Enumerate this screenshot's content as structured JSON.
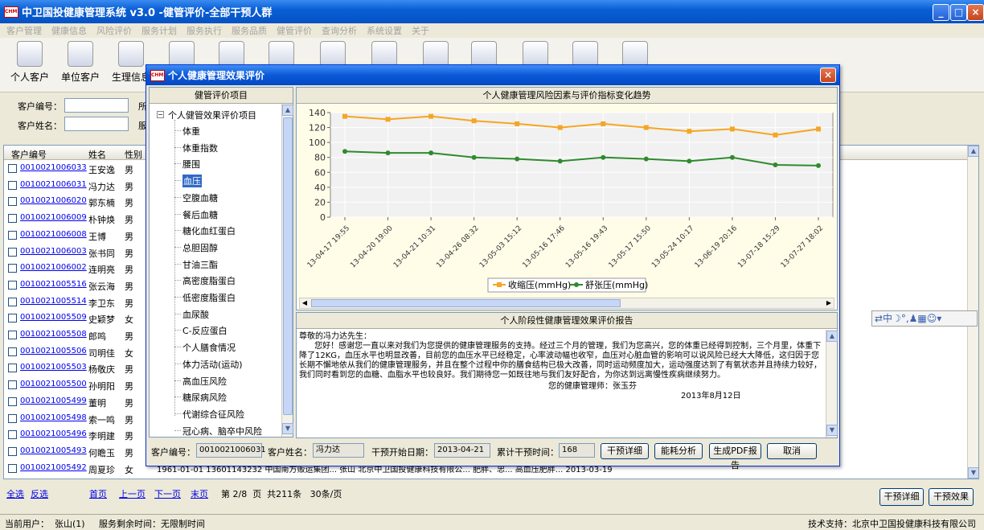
{
  "app": {
    "title": "中卫国投健康管理系统 v3.0 -健管评价-全部干预人群",
    "logo_text": "CHMI",
    "window_buttons": [
      "_",
      "□",
      "×"
    ]
  },
  "menu": [
    "客户管理",
    "健康信息",
    "风险评价",
    "服务计划",
    "服务执行",
    "服务品质",
    "健管评价",
    "查询分析",
    "系统设置",
    "关于"
  ],
  "toolbar": [
    {
      "label": "个人客户",
      "icon": "person-icon"
    },
    {
      "label": "单位客户",
      "icon": "group-icon"
    },
    {
      "label": "生理信息",
      "icon": "document-pencil-icon"
    },
    {
      "label": "",
      "icon": "record-icon"
    },
    {
      "label": "",
      "icon": "magnifier-icon"
    },
    {
      "label": "",
      "icon": "printer-icon"
    },
    {
      "label": "",
      "icon": "add-document-icon"
    },
    {
      "label": "",
      "icon": "warning-icon"
    },
    {
      "label": "",
      "icon": "chart-icon"
    },
    {
      "label": "",
      "icon": "users-icon"
    },
    {
      "label": "",
      "icon": "print-icon"
    },
    {
      "label": "",
      "icon": "refresh-icon"
    },
    {
      "label": "",
      "icon": "power-icon"
    }
  ],
  "filter": {
    "customer_id_label": "客户编号：",
    "customer_name_label": "客户姓名：",
    "hint1": "所",
    "hint2": "服"
  },
  "grid": {
    "headers": [
      "客户编号",
      "姓名",
      "性别"
    ],
    "rows": [
      {
        "id": "0010021006033",
        "name": "王安逸",
        "sex": "男"
      },
      {
        "id": "0010021006031",
        "name": "冯力达",
        "sex": "男"
      },
      {
        "id": "0010021006020",
        "name": "郭东楠",
        "sex": "男"
      },
      {
        "id": "0010021006009",
        "name": "朴钟焕",
        "sex": "男"
      },
      {
        "id": "0010021006008",
        "name": "王博",
        "sex": "男"
      },
      {
        "id": "0010021006003",
        "name": "张书同",
        "sex": "男"
      },
      {
        "id": "0010021006002",
        "name": "连明亮",
        "sex": "男"
      },
      {
        "id": "0010021005516",
        "name": "张云海",
        "sex": "男"
      },
      {
        "id": "0010021005514",
        "name": "李卫东",
        "sex": "男"
      },
      {
        "id": "0010021005509",
        "name": "史颖梦",
        "sex": "女"
      },
      {
        "id": "0010021005508",
        "name": "郎鸣",
        "sex": "男"
      },
      {
        "id": "0010021005506",
        "name": "司明佳",
        "sex": "女"
      },
      {
        "id": "0010021005503",
        "name": "杨敬庆",
        "sex": "男"
      },
      {
        "id": "0010021005500",
        "name": "孙明阳",
        "sex": "男"
      },
      {
        "id": "0010021005499",
        "name": "董明",
        "sex": "男"
      },
      {
        "id": "0010021005498",
        "name": "索一鸣",
        "sex": "男"
      },
      {
        "id": "0010021005496",
        "name": "李明建",
        "sex": "男"
      },
      {
        "id": "0010021005493",
        "name": "何瞻玉",
        "sex": "男"
      },
      {
        "id": "0010021005492",
        "name": "周夏珍",
        "sex": "女"
      }
    ],
    "partial_row": "1961-01-01   13601143232   中国南方贩运集团...   张山   北京中卫国投健康科技有限公...   肥胖、忠...   高血压肥胖...   2013-03-19"
  },
  "pager": {
    "select_all": "全选",
    "invert": "反选",
    "first": "首页",
    "prev": "上一页",
    "next": "下一页",
    "last": "末页",
    "info": "第 2/8  页  共211条   30条/页",
    "btn_detail": "干预详细",
    "btn_result": "干预效果"
  },
  "status": {
    "user": "当前用户：  张山(1)     服务剩余时间：无限制时间",
    "support": "技术支持：北京中卫国投健康科技有限公司"
  },
  "dialog": {
    "title": "个人健康管理效果评价",
    "tree_header": "健管评价项目",
    "tree_root": "个人健管效果评价项目",
    "tree_items": [
      "体重",
      "体重指数",
      "腰围",
      "血压",
      "空腹血糖",
      "餐后血糖",
      "糖化血红蛋白",
      "总胆固醇",
      "甘油三酯",
      "高密度脂蛋白",
      "低密度脂蛋白",
      "血尿酸",
      "C-反应蛋白",
      "个人膳食情况",
      "体力活动(运动)",
      "高血压风险",
      "糖尿病风险",
      "代谢综合征风险",
      "冠心病、脑卒中风险"
    ],
    "selected_index": 3,
    "chart_header": "个人健康管理风险因素与评价指标变化趋势",
    "report_header": "个人阶段性健康管理效果评价报告",
    "report_greeting": "尊敬的冯力达先生：",
    "report_body": "      您好！感谢您一直以来对我们为您提供的健康管理服务的支持。经过三个月的管理，我们为您高兴，您的体重已经得到控制，三个月里，体重下降了12KG，血压水平也明显改善，目前您的血压水平已经稳定，心率波动幅也收窄，血压对心脏血管的影响可以说风险已经大大降低，这归因于您长期不懈地依从我们的健康管理服务，并且在整个过程中你的膳食结构已极大改善，同时运动频度加大，运动强度达到了有氧状态并且持续力较好，我们同时看到您的血糖、血脂水平也较良好。我们期待您一如既往地与我们友好配合，为你达到远离慢性疾病继续努力。",
    "report_signature": "您的健康管理师：张玉芬",
    "report_date": "2013年8月12日",
    "footer": {
      "id_label": "客户编号：",
      "id_value": "0010021006031",
      "name_label": "客户姓名：",
      "name_value": "冯力达",
      "start_label": "干预开始日期：",
      "start_value": "2013-04-21",
      "days_label": "累计干预时间：",
      "days_value": "168",
      "btn_detail": "干预详细",
      "btn_energy": "能耗分析",
      "btn_pdf": "生成PDF报告",
      "btn_cancel": "取消"
    }
  },
  "chart_data": {
    "type": "line",
    "categories": [
      "13-04-17 19:55",
      "13-04-20 19:00",
      "13-04-21 10:31",
      "13-04-26 08:32",
      "13-05-03 15:12",
      "13-05-16 17:46",
      "13-05-16 19:43",
      "13-05-17 15:50",
      "13-05-24 10:17",
      "13-06-19 20:16",
      "13-07-18 15:29",
      "13-07-27 18:02"
    ],
    "series": [
      {
        "name": "收缩压(mmHg)",
        "values": [
          135,
          131,
          135,
          129,
          125,
          120,
          125,
          120,
          115,
          118,
          110,
          118
        ],
        "color": "#f5a623"
      },
      {
        "name": "舒张压(mmHg)",
        "values": [
          88,
          86,
          86,
          80,
          78,
          75,
          80,
          78,
          75,
          80,
          70,
          69
        ],
        "color": "#2e8b2e"
      }
    ],
    "yticks": [
      0,
      20,
      40,
      60,
      80,
      100,
      120,
      140
    ],
    "ylim": [
      0,
      140
    ],
    "grid": true,
    "legend": "bottom"
  }
}
